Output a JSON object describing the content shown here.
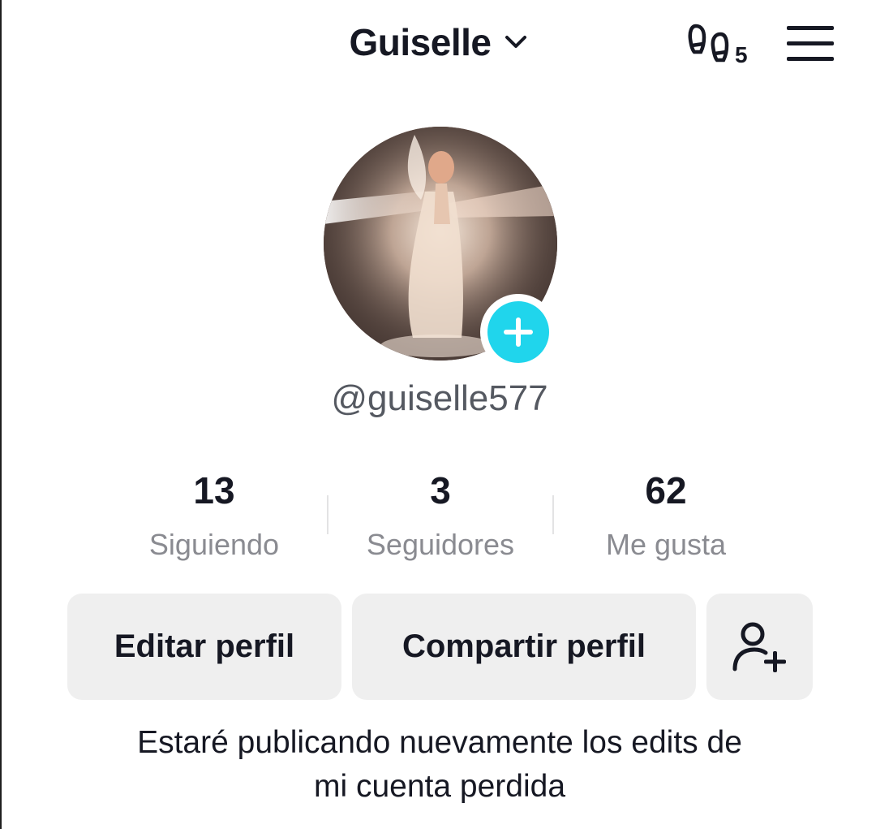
{
  "header": {
    "title": "Guiselle",
    "footprint_count": "5",
    "icons": {
      "dropdown": "chevron-down-icon",
      "profile_views": "footprints-icon",
      "menu": "hamburger-menu-icon"
    }
  },
  "profile": {
    "username": "@guiselle577",
    "avatar_icon": "avatar-image",
    "add_badge_icon": "plus-icon",
    "accent_color": "#20d5ec"
  },
  "stats": [
    {
      "value": "13",
      "label": "Siguiendo"
    },
    {
      "value": "3",
      "label": "Seguidores"
    },
    {
      "value": "62",
      "label": "Me gusta"
    }
  ],
  "actions": {
    "edit_label": "Editar perfil",
    "share_label": "Compartir perfil",
    "add_friend_icon": "add-user-icon"
  },
  "bio": {
    "line1": "Estaré publicando nuevamente los edits de",
    "line2": "mi cuenta perdida"
  }
}
